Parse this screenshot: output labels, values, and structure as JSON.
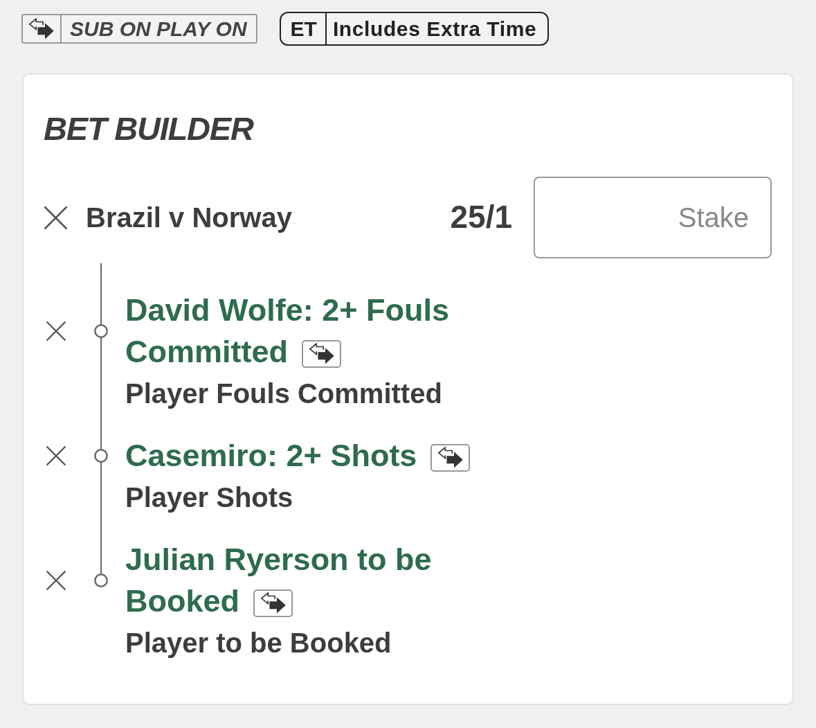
{
  "badges": [
    {
      "kind": "icon",
      "label": "SUB ON PLAY ON"
    },
    {
      "kind": "code",
      "code": "ET",
      "label": "Includes Extra Time"
    }
  ],
  "bet_builder": {
    "title": "BET BUILDER",
    "event": "Brazil v Norway",
    "odds": "25/1",
    "stake": {
      "placeholder": "Stake"
    },
    "selections": [
      {
        "title": "David Wolfe: 2+ Fouls Committed",
        "market": "Player Fouls Committed",
        "sub_on_play_on": true
      },
      {
        "title": "Casemiro: 2+ Shots",
        "market": "Player Shots",
        "sub_on_play_on": true
      },
      {
        "title": "Julian Ryerson to be Booked",
        "market": "Player to be Booked",
        "sub_on_play_on": true
      }
    ]
  }
}
